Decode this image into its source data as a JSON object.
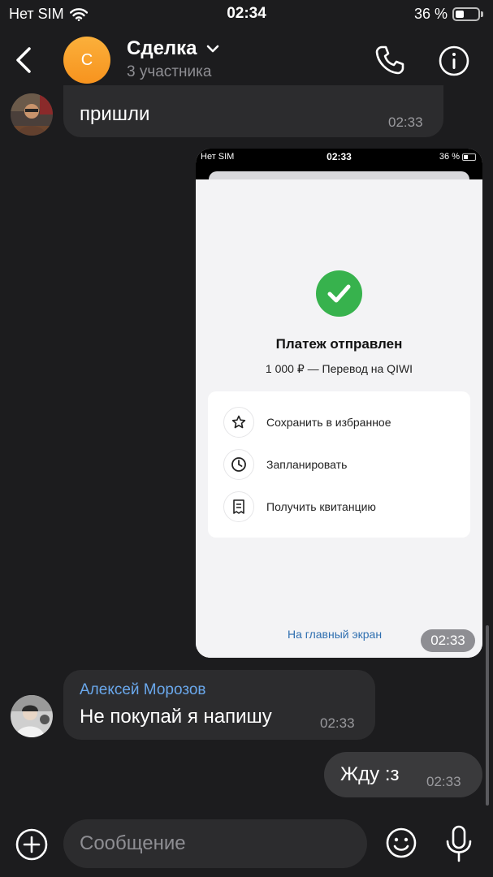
{
  "status_bar": {
    "carrier": "Нет SIM",
    "time": "02:34",
    "battery": "36 %"
  },
  "header": {
    "avatar_letter": "С",
    "title": "Сделка",
    "subtitle": "3 участника",
    "avatar_color": "#f7931e"
  },
  "messages": [
    {
      "type": "incoming",
      "text": "пришли",
      "time": "02:33"
    },
    {
      "type": "outgoing-image",
      "time": "02:33",
      "screenshot": {
        "status": {
          "carrier": "Нет SIM",
          "time": "02:33",
          "battery": "36 %"
        },
        "title": "Платеж отправлен",
        "subtitle": "1 000 ₽ — Перевод на QIWI",
        "actions": [
          {
            "icon": "star-icon",
            "label": "Сохранить в избранное"
          },
          {
            "icon": "clock-icon",
            "label": "Запланировать"
          },
          {
            "icon": "receipt-icon",
            "label": "Получить квитанцию"
          }
        ],
        "home_link": "На главный экран",
        "success_color": "#37b24d"
      }
    },
    {
      "type": "incoming",
      "sender": "Алексей Морозов",
      "text": "Не покупай я напишу",
      "time": "02:33",
      "sender_color": "#6aa8ec"
    },
    {
      "type": "outgoing",
      "text": "Жду :з",
      "time": "02:33"
    }
  ],
  "composer": {
    "placeholder": "Сообщение"
  },
  "colors": {
    "background": "#1c1c1e",
    "incoming_bubble": "#2c2c2e",
    "outgoing_bubble": "#3a3a3c",
    "link": "#2f6fb0"
  }
}
